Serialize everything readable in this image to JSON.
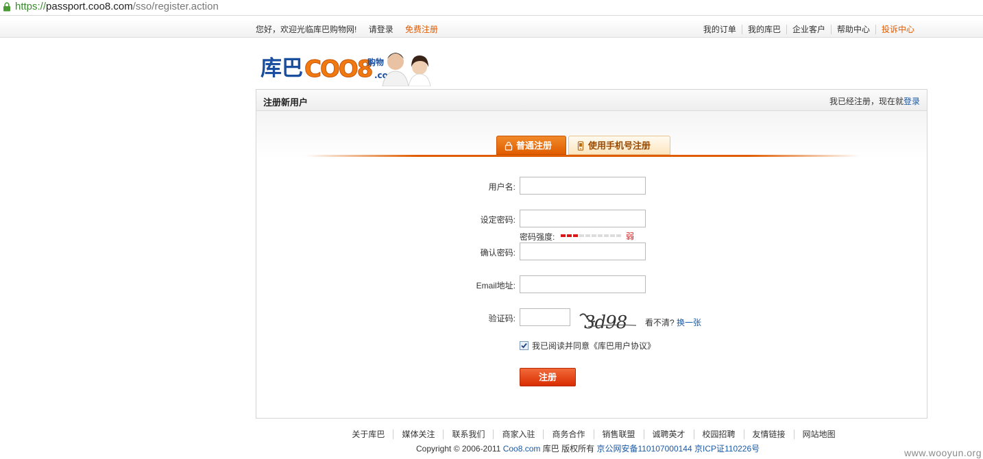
{
  "browser": {
    "url_scheme": "https://",
    "url_host": "passport.coo8.com",
    "url_path": "/sso/register.action"
  },
  "topnav": {
    "welcome": "您好，欢迎光临库巴购物网!",
    "login": "请登录",
    "register": "免费注册",
    "links": [
      "我的订单",
      "我的库巴",
      "企业客户",
      "帮助中心",
      "投诉中心"
    ]
  },
  "logo": {
    "brand_cn": "库巴",
    "brand_en": "COO8",
    "tag": "购物",
    "dotcom": ".com"
  },
  "panel": {
    "title": "注册新用户",
    "login_hint": "我已经注册，现在就",
    "login_link": "登录"
  },
  "tabs": {
    "normal": "普通注册",
    "mobile": "使用手机号注册"
  },
  "form": {
    "username_label": "用户名:",
    "password_label": "设定密码:",
    "strength_label": "密码强度:",
    "strength_value": "弱",
    "strength_level": 0.3,
    "confirm_label": "确认密码:",
    "email_label": "Email地址:",
    "captcha_label": "验证码:",
    "captcha_text": "3d98",
    "captcha_hint": "看不清?",
    "captcha_refresh": "换一张",
    "agree_prefix": "我已阅读并同意",
    "agree_link": "《库巴用户协议》",
    "submit": "注册"
  },
  "footer": {
    "links": [
      "关于库巴",
      "媒体关注",
      "联系我们",
      "商家入驻",
      "商务合作",
      "销售联盟",
      "诚聘英才",
      "校园招聘",
      "友情链接",
      "网站地图"
    ],
    "copyright_prefix": "Copyright © 2006-2011",
    "copyright_site": "Coo8.com",
    "copyright_mid": "库巴 版权所有",
    "icp_police": "京公网安备110107000144",
    "icp": "京ICP证110226号"
  },
  "watermark": "www.wooyun.org",
  "colors": {
    "accent_orange": "#e05c00",
    "link_blue": "#1a5aa6",
    "strength_red": "#d61a1a"
  }
}
